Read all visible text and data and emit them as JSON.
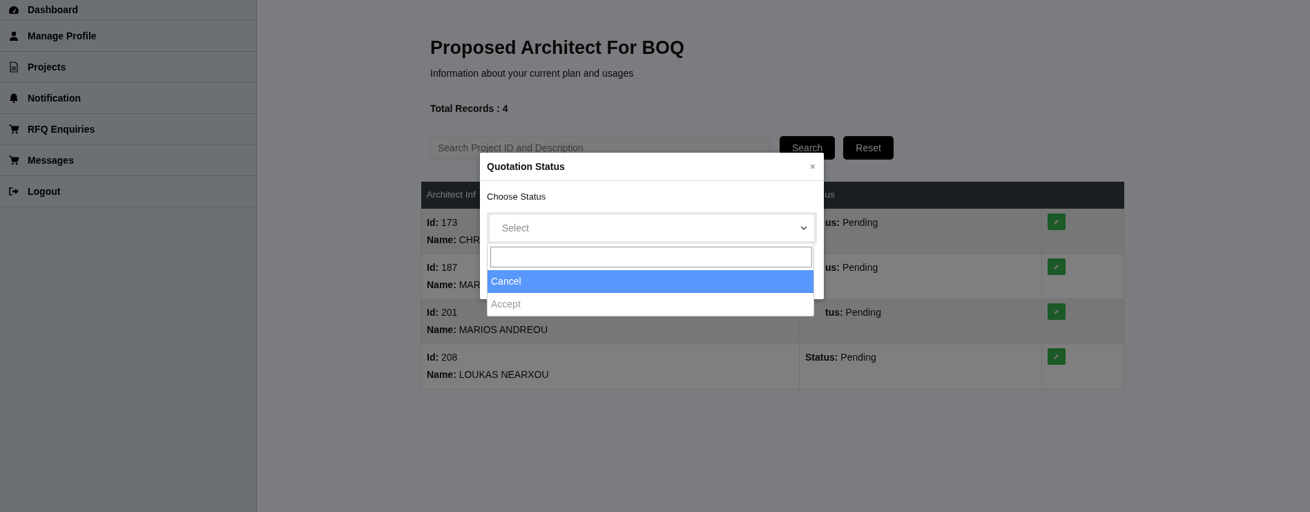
{
  "sidebar": {
    "items": [
      {
        "label": "Dashboard"
      },
      {
        "label": "Manage Profile"
      },
      {
        "label": "Projects"
      },
      {
        "label": "Notification"
      },
      {
        "label": "RFQ Enquiries"
      },
      {
        "label": "Messages"
      },
      {
        "label": "Logout"
      }
    ]
  },
  "page": {
    "title": "Proposed Architect For BOQ",
    "subtitle": "Information about your current plan and usages",
    "total_records": "Total Records : 4"
  },
  "search": {
    "placeholder": "Search Project ID and Description",
    "buttons": [
      "Search",
      "Reset"
    ]
  },
  "table": {
    "columns": [
      {
        "label": "Architect Inf"
      },
      {
        "label": "us",
        "clipped": true
      }
    ],
    "rows": [
      {
        "id_label": "Id:",
        "id": "173",
        "name_label": "Name:",
        "name": "CHR",
        "status_label": "us:",
        "status": "Pending",
        "clipped": true
      },
      {
        "id_label": "Id:",
        "id": "187",
        "name_label": "Name:",
        "name": "MAR",
        "status_label": "us:",
        "status": "Pending",
        "clipped": true
      },
      {
        "id_label": "Id:",
        "id": "201",
        "name_label": "Name:",
        "name": "MARIOS ANDREOU",
        "status_label": "tus:",
        "status": "Pending",
        "clipped": true
      },
      {
        "id_label": "Id:",
        "id": "208",
        "name_label": "Name:",
        "name": "LOUKAS NEARXOU",
        "status_label": "Status:",
        "status": "Pending"
      }
    ]
  },
  "modal": {
    "title": "Quotation Status",
    "close": "×",
    "label": "Choose Status",
    "select_placeholder": "Select",
    "options": [
      {
        "label": "Cancel",
        "selected": true,
        "disabled": false
      },
      {
        "label": "Accept",
        "selected": false,
        "disabled": true
      }
    ]
  }
}
